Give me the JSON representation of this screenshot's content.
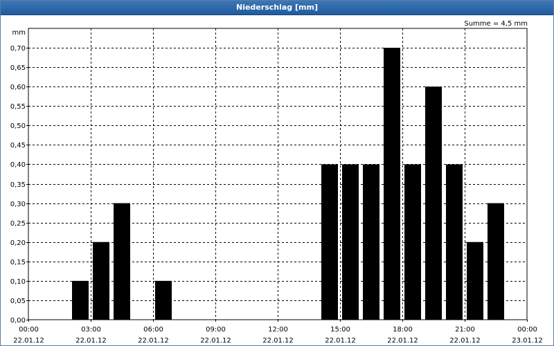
{
  "title": "Niederschlag [mm]",
  "annotation": "Summe = 4,5 mm",
  "unit": "mm",
  "chart_data": {
    "type": "bar",
    "title": "Niederschlag [mm]",
    "ylabel": "mm",
    "xlabel": "",
    "ylim": [
      0,
      0.75
    ],
    "xlim_hours": [
      0,
      24
    ],
    "grid": true,
    "annotation": "Summe = 4,5 mm",
    "y_ticks": [
      "0,00",
      "0,05",
      "0,10",
      "0,15",
      "0,20",
      "0,25",
      "0,30",
      "0,35",
      "0,40",
      "0,45",
      "0,50",
      "0,55",
      "0,60",
      "0,65",
      "0,70"
    ],
    "x_ticks": [
      {
        "time": "00:00",
        "date": "22.01.12"
      },
      {
        "time": "03:00",
        "date": "22.01.12"
      },
      {
        "time": "06:00",
        "date": "22.01.12"
      },
      {
        "time": "09:00",
        "date": "22.01.12"
      },
      {
        "time": "12:00",
        "date": "22.01.12"
      },
      {
        "time": "15:00",
        "date": "22.01.12"
      },
      {
        "time": "18:00",
        "date": "22.01.12"
      },
      {
        "time": "21:00",
        "date": "22.01.12"
      },
      {
        "time": "00:00",
        "date": "23.01.12"
      }
    ],
    "bars": [
      {
        "hour": 3,
        "value": 0.1
      },
      {
        "hour": 4,
        "value": 0.2
      },
      {
        "hour": 5,
        "value": 0.3
      },
      {
        "hour": 7,
        "value": 0.1
      },
      {
        "hour": 15,
        "value": 0.4
      },
      {
        "hour": 16,
        "value": 0.4
      },
      {
        "hour": 17,
        "value": 0.4
      },
      {
        "hour": 18,
        "value": 0.7
      },
      {
        "hour": 19,
        "value": 0.4
      },
      {
        "hour": 20,
        "value": 0.6
      },
      {
        "hour": 21,
        "value": 0.4
      },
      {
        "hour": 22,
        "value": 0.2
      },
      {
        "hour": 23,
        "value": 0.3
      }
    ],
    "colors": {
      "bar": "#000000",
      "grid": "#000000",
      "titlebar": "#2a68a8"
    }
  }
}
